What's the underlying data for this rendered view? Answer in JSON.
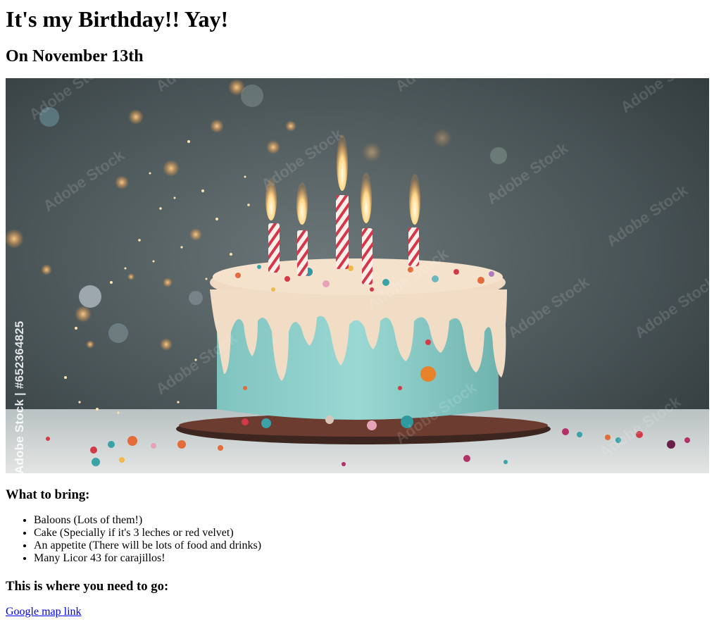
{
  "header": {
    "title": "It's my Birthday!! Yay!",
    "subtitle": "On November 13th"
  },
  "hero_image": {
    "description_icon": "birthday-cake-image",
    "watermark_text": "Adobe Stock | #652364825",
    "stock_watermark": "Adobe Stock"
  },
  "bring": {
    "heading": "What to bring:",
    "items": [
      "Baloons (Lots of them!)",
      "Cake (Specially if it's 3 leches or red velvet)",
      "An appetite (There will be lots of food and drinks)",
      "Many Licor 43 for carajillos!"
    ]
  },
  "location": {
    "heading": "This is where you need to go:",
    "link_label": "Google map link"
  },
  "colors": {
    "link": "#0000ee",
    "cake_frosting": "#8fd0cc",
    "drip": "#f1dcc6"
  }
}
